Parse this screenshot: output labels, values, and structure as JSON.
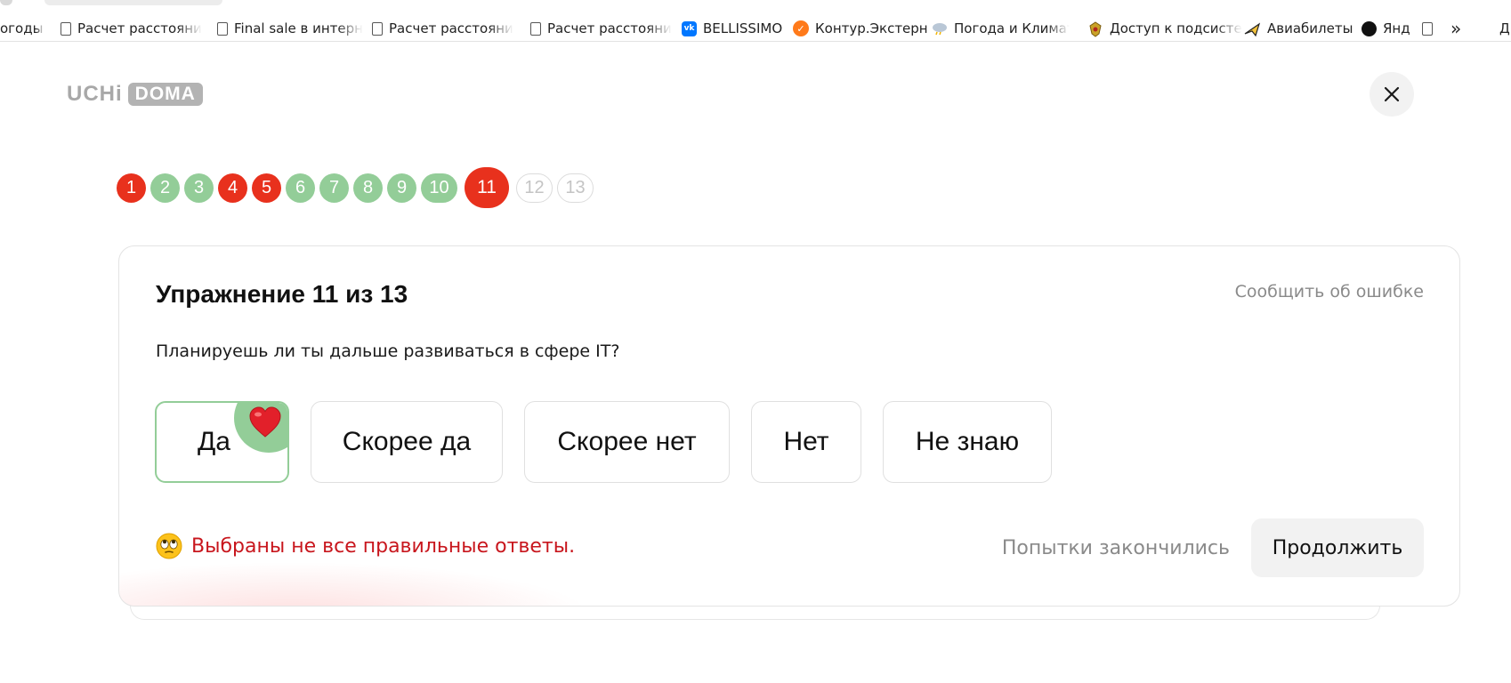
{
  "bookmarks": [
    {
      "label": "огоды в",
      "icon": "none"
    },
    {
      "label": "Расчет расстояни",
      "icon": "document-icon"
    },
    {
      "label": "Final sale в интерн",
      "icon": "document-icon"
    },
    {
      "label": "Расчет расстояни",
      "icon": "document-icon"
    },
    {
      "label": "Расчет расстояни",
      "icon": "document-icon"
    },
    {
      "label": "BELLISSIMO",
      "icon": "vk-icon"
    },
    {
      "label": "Контур.Экстерн",
      "icon": "kontur-icon"
    },
    {
      "label": "Погода и Климат",
      "icon": "weather-icon"
    },
    {
      "label": "Доступ к подсисте",
      "icon": "emblem-icon"
    },
    {
      "label": "Авиабилеты",
      "icon": "airplane-icon"
    },
    {
      "label": "Янд",
      "icon": "yandex-icon"
    },
    {
      "label": "Д",
      "icon": "none"
    }
  ],
  "bookmarks_overflow": "»",
  "logo": {
    "part1": "UCHi",
    "part2": "DOMA"
  },
  "close_icon": "✕",
  "progress": [
    {
      "n": "1",
      "state": "wrong"
    },
    {
      "n": "2",
      "state": "correct"
    },
    {
      "n": "3",
      "state": "correct"
    },
    {
      "n": "4",
      "state": "wrong"
    },
    {
      "n": "5",
      "state": "wrong"
    },
    {
      "n": "6",
      "state": "correct"
    },
    {
      "n": "7",
      "state": "correct"
    },
    {
      "n": "8",
      "state": "correct"
    },
    {
      "n": "9",
      "state": "correct"
    },
    {
      "n": "10",
      "state": "correct"
    },
    {
      "n": "11",
      "state": "current"
    },
    {
      "n": "12",
      "state": "todo"
    },
    {
      "n": "13",
      "state": "todo"
    }
  ],
  "colors": {
    "wrong": "#e8311d",
    "correct": "#93cd98",
    "error_text": "#c8161d"
  },
  "exercise": {
    "title": "Упражнение 11 из 13",
    "report": "Сообщить об ошибке",
    "question": "Планируешь ли ты дальше развиваться в сфере IT?",
    "options": [
      {
        "label": "Да",
        "selected": true
      },
      {
        "label": "Скорее да",
        "selected": false
      },
      {
        "label": "Скорее нет",
        "selected": false
      },
      {
        "label": "Нет",
        "selected": false
      },
      {
        "label": "Не знаю",
        "selected": false
      }
    ],
    "feedback": "Выбраны не все правильные ответы.",
    "feedback_emoji": "rolling-eyes-emoji",
    "attempts": "Попытки закончились",
    "continue": "Продолжить"
  }
}
